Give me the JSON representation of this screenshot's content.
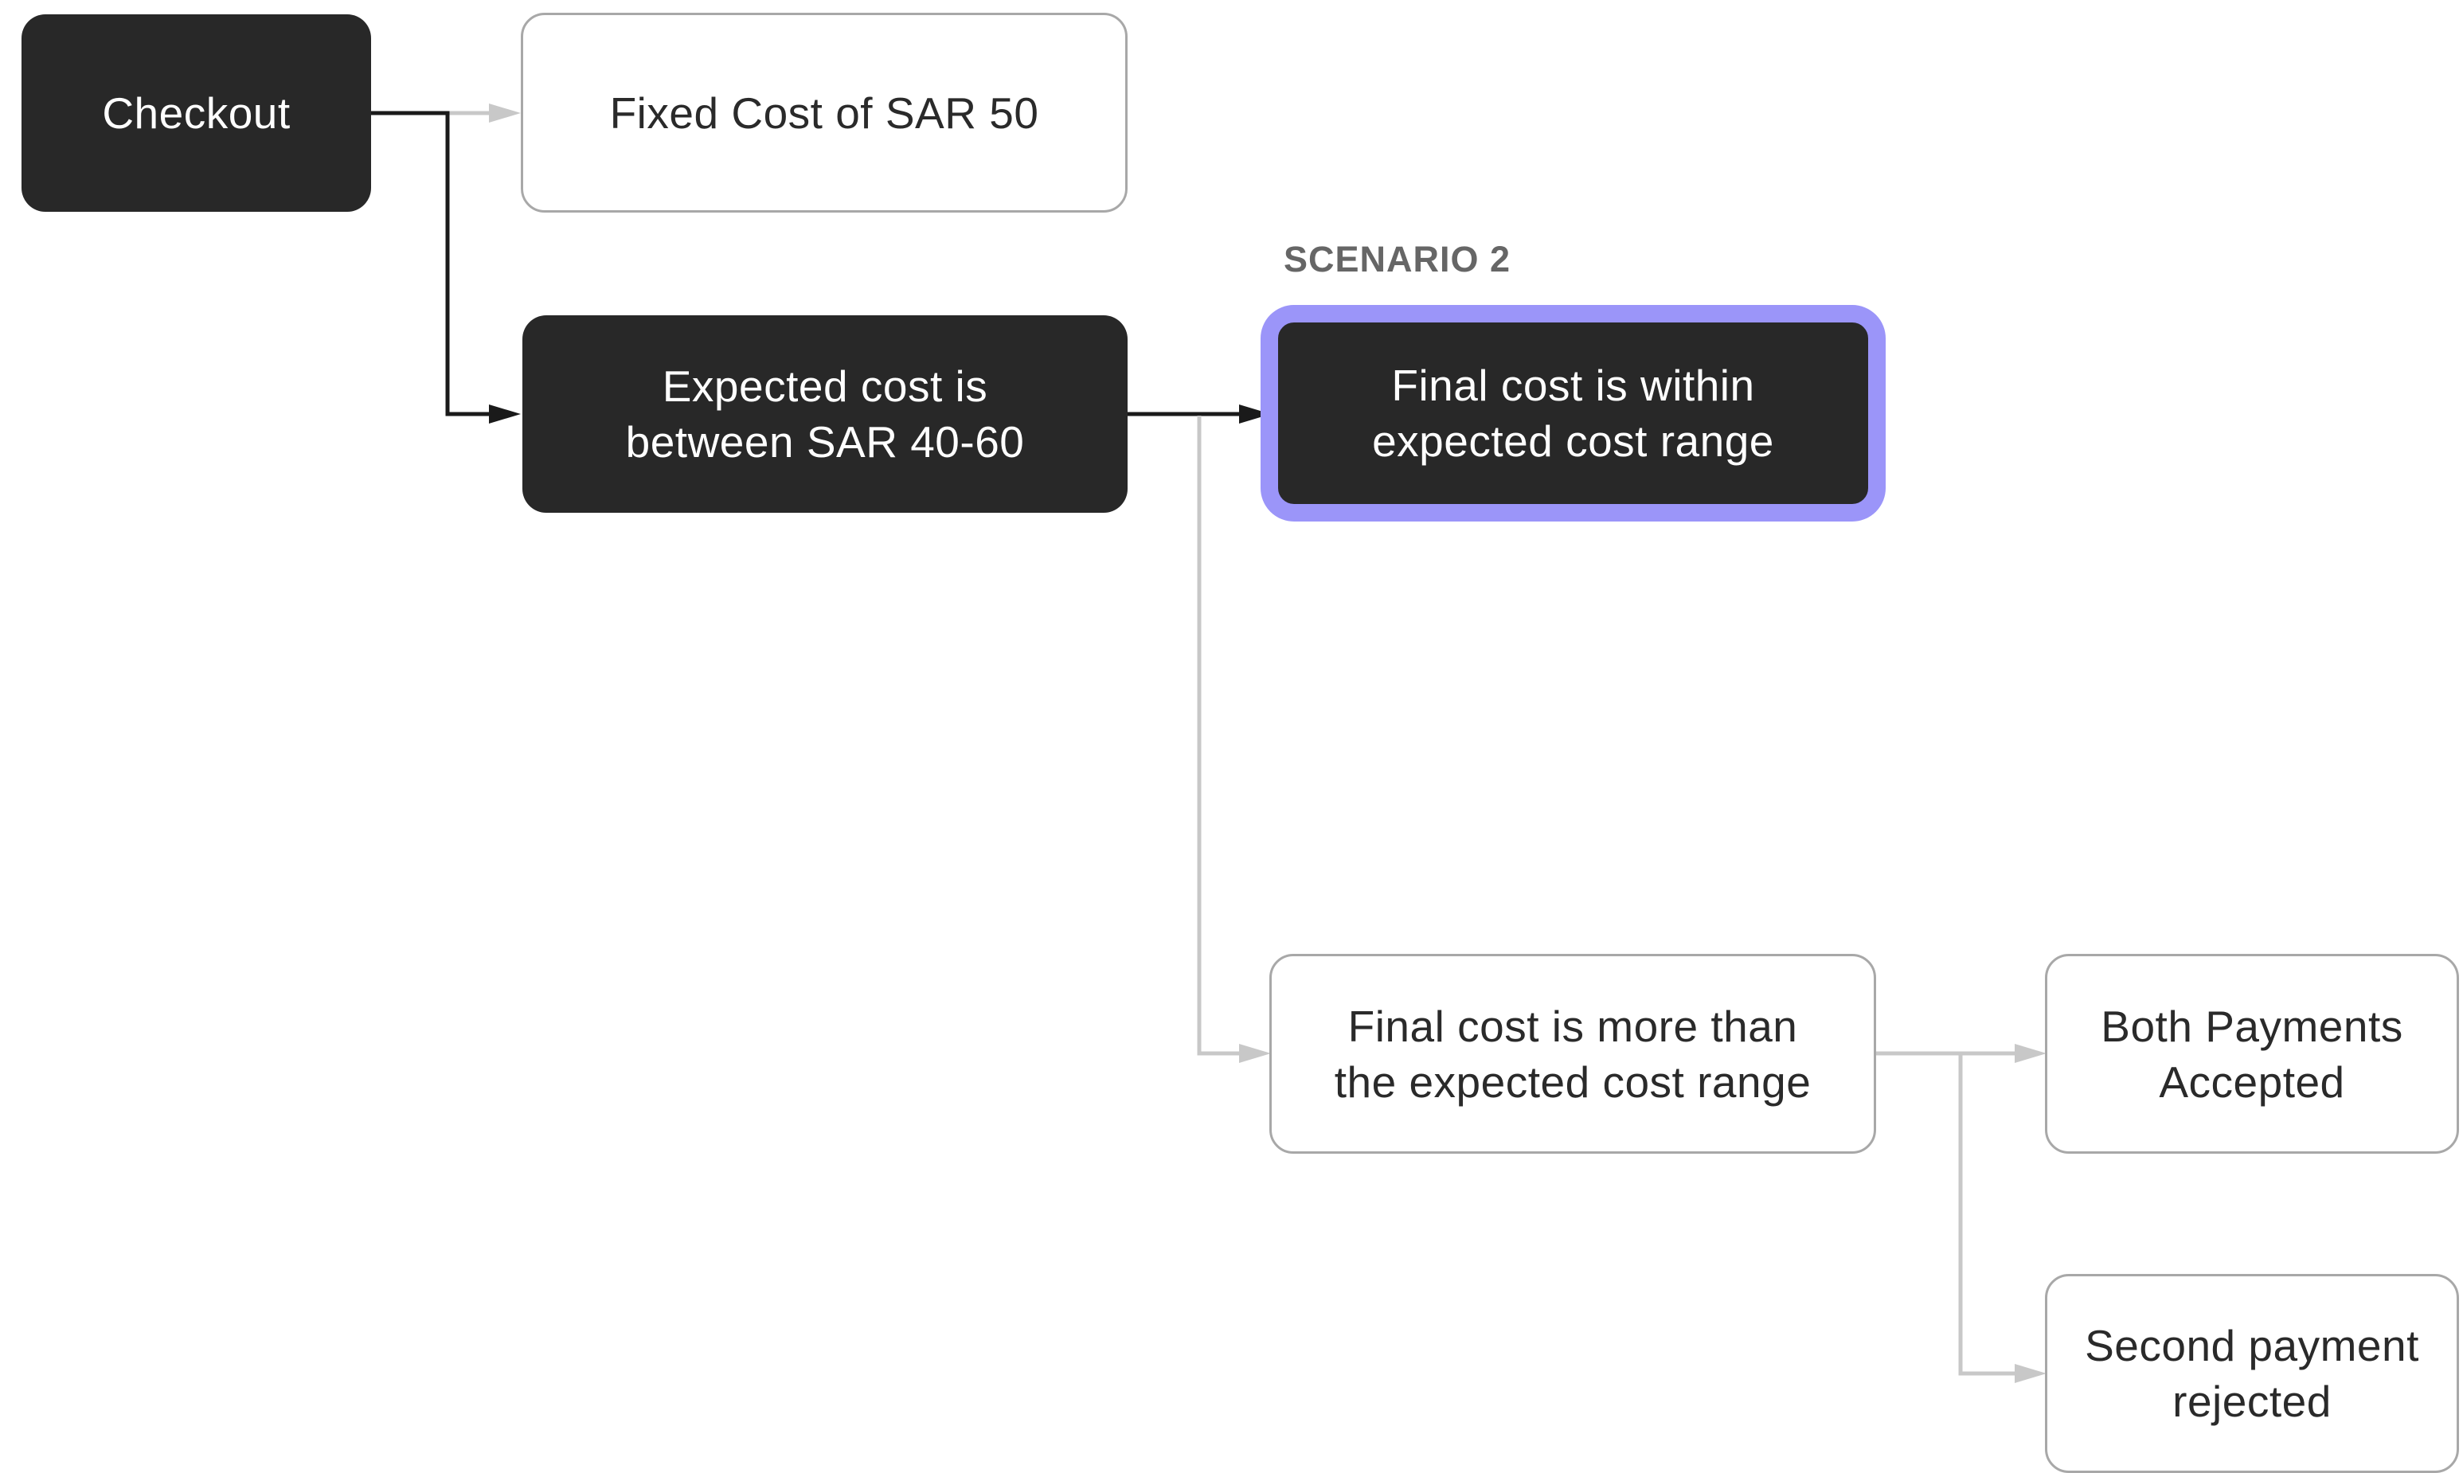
{
  "diagram": {
    "scenario_label": "SCENARIO 2",
    "nodes": {
      "checkout": "Checkout",
      "fixed_cost": "Fixed Cost of SAR 50",
      "expected_cost": "Expected cost is\nbetween SAR 40-60",
      "final_within": "Final cost is within\nexpected cost range",
      "final_more": "Final cost is more than\nthe  expected cost range",
      "both_accepted": "Both Payments\nAccepted",
      "second_rejected": "Second payment\nrejected"
    },
    "colors": {
      "dark_node": "#282828",
      "light_border": "#a8a8a8",
      "active_edge": "#1a1a1a",
      "inactive_edge": "#c8c8c8",
      "highlight": "#9b95f9",
      "scenario_text": "#666666"
    }
  }
}
